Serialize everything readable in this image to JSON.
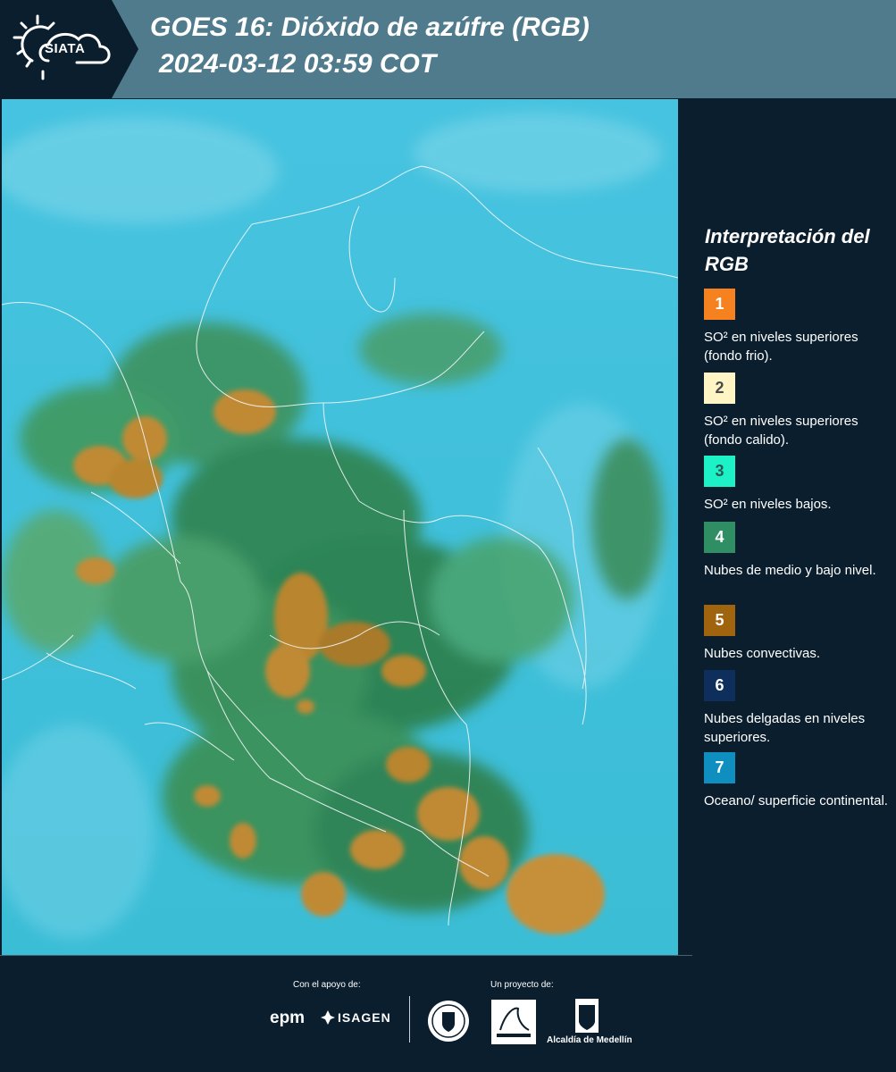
{
  "header": {
    "logo_text": "SIATA",
    "title_line1": "GOES 16: Dióxido de azúfre (RGB)",
    "title_line2": "2024-03-12 03:59 COT"
  },
  "map": {
    "icon": "satellite-rgb-map",
    "colors": {
      "ocean": "#3cbfd9",
      "low_cloud": "#2f8a4a",
      "convective": "#b8862c",
      "border": "#f2f6f8"
    }
  },
  "legend": {
    "title": "Interpretación del RGB",
    "items": [
      {
        "number": "1",
        "color": "#f5821f",
        "text_color": "#ffffff",
        "description": "SO² en niveles superiores (fondo frio)."
      },
      {
        "number": "2",
        "color": "#fff4c4",
        "text_color": "#4a4a4a",
        "description": "SO² en niveles superiores (fondo calido)."
      },
      {
        "number": "3",
        "color": "#1cf2c6",
        "text_color": "#2a5a55",
        "description": "SO² en niveles bajos."
      },
      {
        "number": "4",
        "color": "#2f8e63",
        "text_color": "#ffffff",
        "description": "Nubes de medio y bajo nivel."
      },
      {
        "number": "5",
        "color": "#a0640f",
        "text_color": "#ffffff",
        "description": "Nubes convectivas."
      },
      {
        "number": "6",
        "color": "#0e2f5c",
        "text_color": "#ffffff",
        "description": "Nubes delgadas en niveles superiores."
      },
      {
        "number": "7",
        "color": "#0f8fc0",
        "text_color": "#ffffff",
        "description": "Oceano/ superficie continental."
      }
    ]
  },
  "footer": {
    "support_label": "Con el apoyo de:",
    "project_label": "Un proyecto de:",
    "epm": "epm",
    "isagen": "ISAGEN",
    "alcaldia": "Alcaldía de Medellín"
  }
}
